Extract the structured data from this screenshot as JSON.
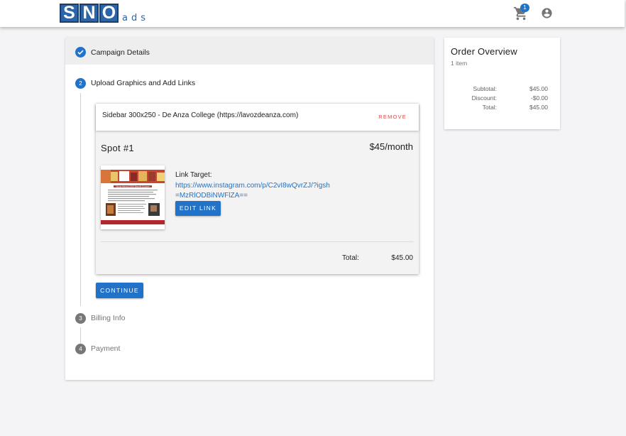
{
  "header": {
    "logo_letters": [
      "S",
      "N",
      "O"
    ],
    "logo_suffix": "ads",
    "cart_count": "1",
    "accent_color": "#2173c9"
  },
  "steps": [
    {
      "number": "1",
      "label": "Campaign Details",
      "status": "completed"
    },
    {
      "number": "2",
      "label": "Upload Graphics and Add Links",
      "status": "active"
    },
    {
      "number": "3",
      "label": "Billing Info",
      "status": "inactive"
    },
    {
      "number": "4",
      "label": "Payment",
      "status": "inactive"
    }
  ],
  "spot": {
    "title": "Sidebar 300x250 - De Anza College (https://lavozdeanza.com)",
    "remove_label": "REMOVE",
    "name": "Spot #1",
    "price": "$45/month",
    "thumbnail_title": "Study Abroad 2024 Benefit Concert",
    "link_label": "Link Target:",
    "link_url": "https://www.instagram.com/p/C2vI8wQvrZJ/?igsh=MzRlODBiNWFlZA==",
    "edit_label": "EDIT LINK",
    "total_label": "Total:",
    "total_value": "$45.00"
  },
  "continue_label": "CONTINUE",
  "order": {
    "title": "Order Overview",
    "item_count": "1 item",
    "rows": [
      {
        "label": "Subtotal:",
        "value": "$45.00"
      },
      {
        "label": "Discount:",
        "value": "-$0.00"
      },
      {
        "label": "Total:",
        "value": "$45.00"
      }
    ]
  }
}
